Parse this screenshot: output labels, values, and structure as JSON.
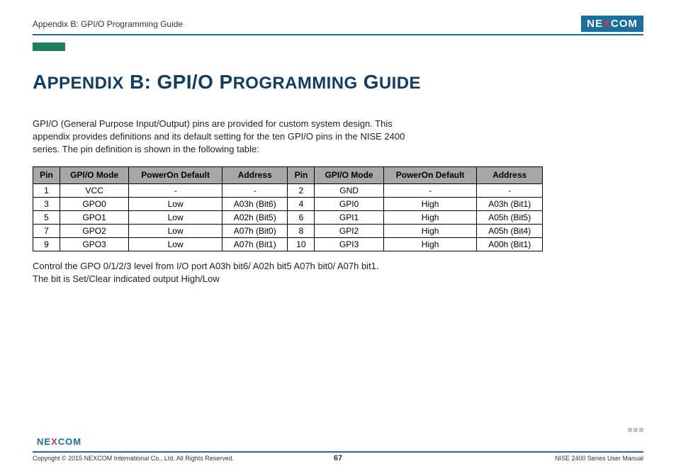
{
  "header": {
    "breadcrumb": "Appendix B: GPI/O Programming Guide",
    "logo_text_1": "NE",
    "logo_text_x": "X",
    "logo_text_2": "COM"
  },
  "title": "Appendix B: GPI/O Programming Guide",
  "intro": "GPI/O (General Purpose Input/Output) pins are provided for custom system design. This appendix provides definitions and its default setting for the ten GPI/O pins in the NISE 2400 series. The pin definition is shown in the following table:",
  "table": {
    "headers": [
      "Pin",
      "GPI/O Mode",
      "PowerOn Default",
      "Address",
      "Pin",
      "GPI/O Mode",
      "PowerOn Default",
      "Address"
    ],
    "rows": [
      [
        "1",
        "VCC",
        "-",
        "-",
        "2",
        "GND",
        "-",
        "-"
      ],
      [
        "3",
        "GPO0",
        "Low",
        "A03h (Bit6)",
        "4",
        "GPI0",
        "High",
        "A03h (Bit1)"
      ],
      [
        "5",
        "GPO1",
        "Low",
        "A02h (Bit5)",
        "6",
        "GPI1",
        "High",
        "A05h (Bit5)"
      ],
      [
        "7",
        "GPO2",
        "Low",
        "A07h (Bit0)",
        "8",
        "GPI2",
        "High",
        "A05h (Bit4)"
      ],
      [
        "9",
        "GPO3",
        "Low",
        "A07h (Bit1)",
        "10",
        "GPI3",
        "High",
        "A00h (Bit1)"
      ]
    ]
  },
  "notes_line1": "Control the GPO 0/1/2/3 level from I/O port A03h bit6/ A02h bit5 A07h bit0/ A07h bit1.",
  "notes_line2": "The bit is Set/Clear indicated output High/Low",
  "footer": {
    "copyright": "Copyright © 2015 NEXCOM International Co., Ltd. All Rights Reserved.",
    "page_number": "67",
    "doc_title": "NISE 2400 Series User Manual"
  }
}
